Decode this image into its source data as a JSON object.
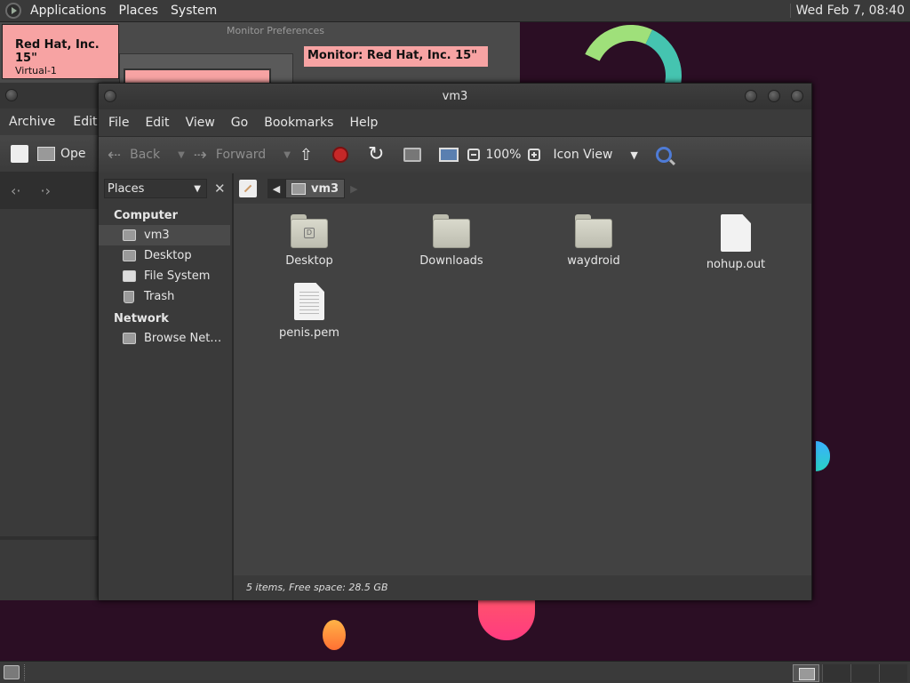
{
  "top_panel": {
    "menus": [
      "Applications",
      "Places",
      "System"
    ],
    "clock": "Wed Feb  7, 08:40"
  },
  "monitor_preferences": {
    "title": "Monitor Preferences",
    "monitor_name": "Red Hat, Inc. 15\"",
    "monitor_sub": "Virtual-1",
    "monitor_label": "Monitor: Red Hat, Inc. 15\""
  },
  "archive_manager": {
    "menus": [
      "Archive",
      "Edit"
    ],
    "toolbar_open": "Ope"
  },
  "file_manager": {
    "title": "vm3",
    "menus": [
      "File",
      "Edit",
      "View",
      "Go",
      "Bookmarks",
      "Help"
    ],
    "toolbar": {
      "back": "Back",
      "forward": "Forward",
      "zoom": "100%",
      "view_mode": "Icon View"
    },
    "sidebar": {
      "selector": "Places",
      "groups": [
        {
          "label": "Computer",
          "items": [
            "vm3",
            "Desktop",
            "File System",
            "Trash"
          ]
        },
        {
          "label": "Network",
          "items": [
            "Browse Net…"
          ]
        }
      ],
      "selected": "vm3"
    },
    "pathbar": {
      "current": "vm3"
    },
    "files": [
      {
        "name": "Desktop",
        "type": "folder"
      },
      {
        "name": "Downloads",
        "type": "folder"
      },
      {
        "name": "waydroid",
        "type": "folder"
      },
      {
        "name": "nohup.out",
        "type": "file"
      },
      {
        "name": "penis.pem",
        "type": "text-file"
      }
    ],
    "status": "5 items, Free space: 28.5 GB"
  },
  "colors": {
    "desktop_bg": "#2b0e24",
    "panel_bg": "#3a3a3a",
    "monitor_highlight": "#f7a3a3",
    "stop_red": "#c62828"
  }
}
